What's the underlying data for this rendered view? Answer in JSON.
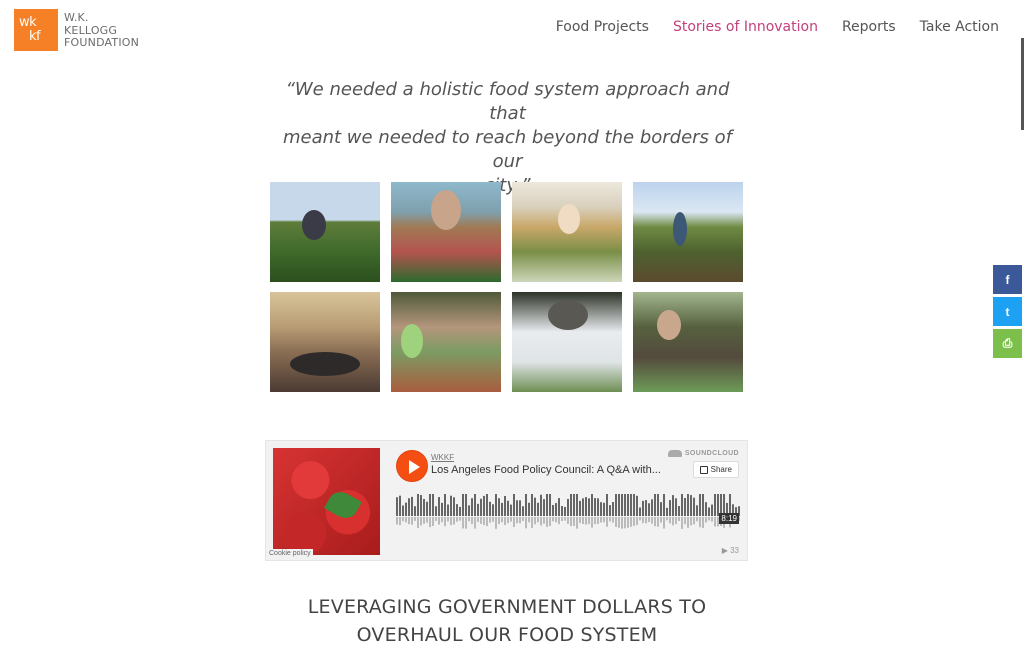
{
  "header": {
    "logo_mark_top": "wk",
    "logo_mark_bottom": "kf",
    "logo_line1": "W.K.",
    "logo_line2": "KELLOGG",
    "logo_line3": "FOUNDATION",
    "nav": [
      {
        "label": "Food Projects"
      },
      {
        "label": "Stories of Innovation"
      },
      {
        "label": "Reports"
      },
      {
        "label": "Take Action"
      }
    ]
  },
  "quote": {
    "line1": "“We needed a holistic food system approach and that",
    "line2": "meant we needed to reach beyond the borders of our",
    "line3": "city.”"
  },
  "photos": [
    "farmworker-in-field",
    "vendor-with-radishes",
    "market-stall-greens",
    "child-in-field",
    "audience-crowd",
    "couple-with-ebt-signs",
    "cook-with-herbs",
    "man-at-food-stand"
  ],
  "player": {
    "uploader": "WKKF",
    "track_title": "Los Angeles Food Policy Council: A Q&A with...",
    "brand": "SOUNDCLOUD",
    "share_label": "Share",
    "duration": "8:19",
    "plays": "▶ 33",
    "cookie_label": "Cookie policy"
  },
  "section": {
    "heading_line1": "LEVERAGING GOVERNMENT DOLLARS TO",
    "heading_line2": "OVERHAUL OUR FOOD SYSTEM"
  },
  "social": {
    "facebook": "f",
    "twitter": "t",
    "print": "⎙"
  },
  "colors": {
    "brand_orange": "#f58025",
    "active_nav": "#c2407e",
    "soundcloud_orange": "#f44e12"
  }
}
